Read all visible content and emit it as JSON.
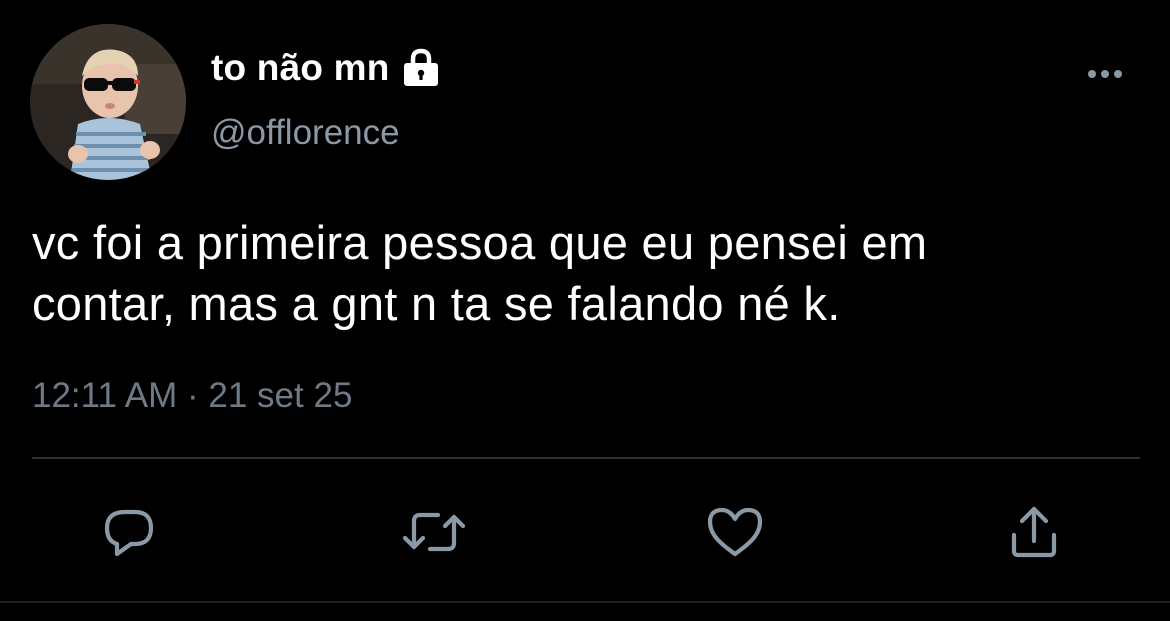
{
  "user": {
    "display_name": "to não mn",
    "handle": "@offlorence",
    "protected_icon": "lock-icon",
    "avatar_icon": "avatar-photo"
  },
  "tweet": {
    "text": "vc foi a primeira pessoa que eu pensei em\ncontar, mas a gnt n ta se falando né k.",
    "time": "12:11 AM",
    "separator": "·",
    "date": "21 set 25"
  },
  "actions": [
    {
      "icon": "reply-icon"
    },
    {
      "icon": "retweet-icon"
    },
    {
      "icon": "like-icon"
    },
    {
      "icon": "share-icon"
    }
  ],
  "menu_icon": "more-options-icon",
  "colors": {
    "background": "#000000",
    "primary_text": "#ffffff",
    "secondary_text": "#8b98a5",
    "icon": "#8b98a5",
    "divider": "#2f3336"
  }
}
